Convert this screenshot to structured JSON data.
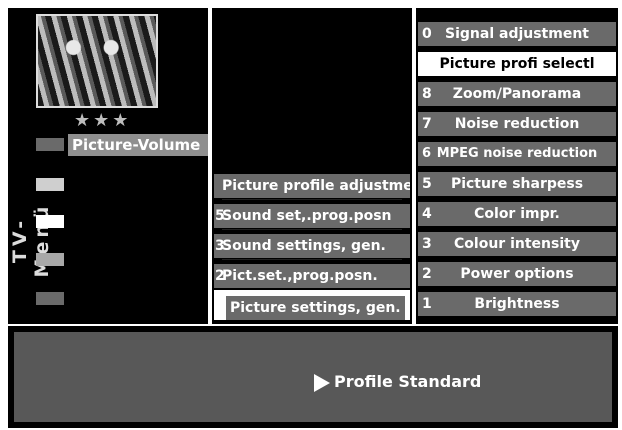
{
  "sidebar": {
    "vertical_label": "TV-Menü",
    "rating_stars": "★★★",
    "picture_volume_label": "Picture-Volume"
  },
  "middle_menu": {
    "items": [
      {
        "num": "",
        "label": "Picture profile adjustment"
      },
      {
        "num": "5",
        "label": "Sound set,.prog.posn"
      },
      {
        "num": "3",
        "label": "Sound settings, gen."
      },
      {
        "num": "2",
        "label": "Pict.set.,prog.posn."
      },
      {
        "num": "",
        "label": "Picture settings, gen.",
        "selected": true
      }
    ]
  },
  "right_menu": {
    "items": [
      {
        "num": "0",
        "label": "Signal adjustment"
      },
      {
        "num": "",
        "label": "Picture profi selectl",
        "selected": true
      },
      {
        "num": "8",
        "label": "Zoom/Panorama"
      },
      {
        "num": "7",
        "label": "Noise reduction"
      },
      {
        "num": "6",
        "label": "MPEG noise reduction"
      },
      {
        "num": "5",
        "label": "Picture sharpess"
      },
      {
        "num": "4",
        "label": "Color impr."
      },
      {
        "num": "3",
        "label": "Colour intensity"
      },
      {
        "num": "2",
        "label": "Power options"
      },
      {
        "num": "1",
        "label": "Brightness"
      }
    ]
  },
  "bottom": {
    "profile_label": "Profile Standard"
  },
  "colors": {
    "background": "#000000",
    "item": "#6a6a6a",
    "highlight": "#ffffff"
  }
}
